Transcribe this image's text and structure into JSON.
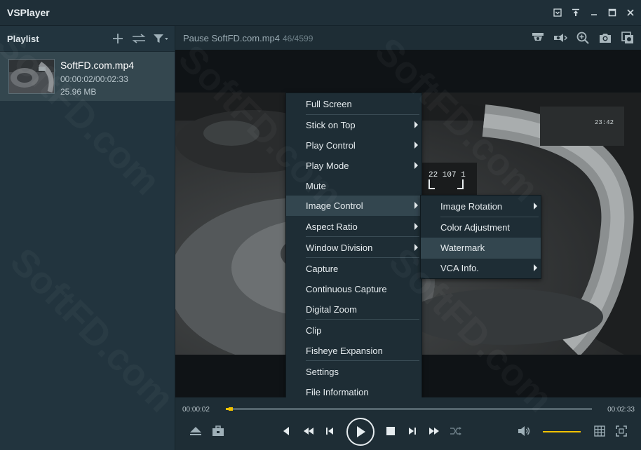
{
  "window": {
    "title": "VSPlayer"
  },
  "playlist": {
    "title": "Playlist",
    "items": [
      {
        "name": "SoftFD.com.mp4",
        "time": "00:00:02/00:02:33",
        "size": "25.96 MB"
      }
    ]
  },
  "status": {
    "text": "Pause SoftFD.com.mp4",
    "counter": "46/4599"
  },
  "player": {
    "elapsed": "00:00:02",
    "duration": "00:02:33",
    "progress": 0.013,
    "volume": 0.6
  },
  "context_menu": {
    "items": [
      {
        "label": "Full Screen"
      },
      {
        "label": "Stick on Top"
      },
      {
        "label": "Play Control"
      },
      {
        "label": "Play Mode"
      },
      {
        "label": "Mute"
      },
      {
        "label": "Image Control"
      },
      {
        "label": "Aspect Ratio"
      },
      {
        "label": "Window Division"
      },
      {
        "label": "Capture"
      },
      {
        "label": "Continuous Capture"
      },
      {
        "label": "Digital Zoom"
      },
      {
        "label": "Clip"
      },
      {
        "label": "Fisheye Expansion"
      },
      {
        "label": "Settings"
      },
      {
        "label": "File Information"
      }
    ],
    "submenu": [
      {
        "label": "Image Rotation"
      },
      {
        "label": "Color Adjustment"
      },
      {
        "label": "Watermark"
      },
      {
        "label": "VCA Info."
      }
    ]
  },
  "video": {
    "dash_readout": "22 107 1",
    "clock": "23:42"
  },
  "watermark": "SoftFD.com"
}
